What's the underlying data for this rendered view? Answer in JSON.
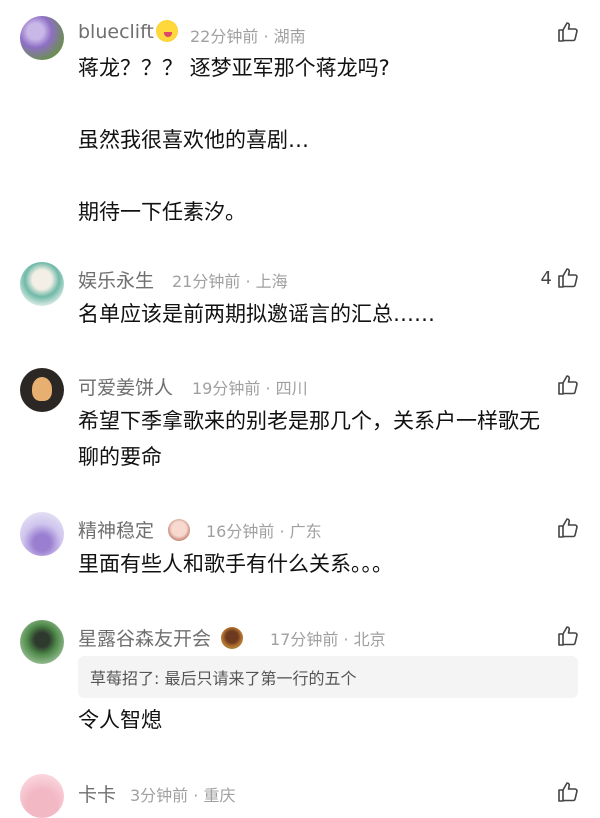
{
  "comments": [
    {
      "user": "blueclift",
      "time": "22分钟前",
      "location": "湖南",
      "likes": "",
      "lines": [
        "蒋龙？？？ 逐梦亚军那个蒋龙吗?",
        "",
        "虽然我很喜欢他的喜剧…",
        "",
        "期待一下任素汐。"
      ]
    },
    {
      "user": "娱乐永生",
      "time": "21分钟前",
      "location": "上海",
      "likes": "4",
      "lines": [
        "名单应该是前两期拟邀谣言的汇总……"
      ]
    },
    {
      "user": "可爱姜饼人",
      "time": "19分钟前",
      "location": "四川",
      "likes": "",
      "lines": [
        "希望下季拿歌来的别老是那几个，关系户一样歌无",
        "聊的要命"
      ]
    },
    {
      "user": "精神稳定",
      "time": "16分钟前",
      "location": "广东",
      "likes": "",
      "lines": [
        "里面有些人和歌手有什么关系。。。"
      ]
    },
    {
      "user": "星露谷森友开会",
      "time": "17分钟前",
      "location": "北京",
      "likes": "",
      "reply": {
        "author": "草莓招了:",
        "text": "最后只请来了第一行的五个"
      },
      "lines": [
        "令人智熄"
      ]
    },
    {
      "user": "卡卡",
      "time": "3分钟前",
      "location": "重庆",
      "likes": "",
      "lines": []
    }
  ],
  "separator": "·",
  "icons": {
    "like": "thumbs-up-icon"
  }
}
